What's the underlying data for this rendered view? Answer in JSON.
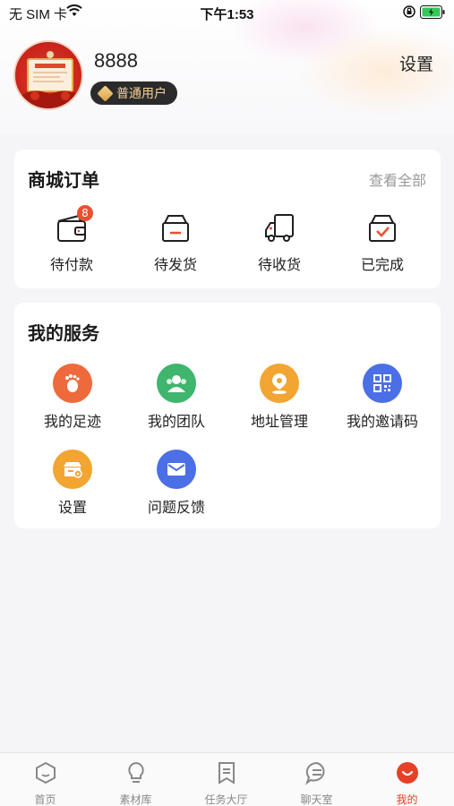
{
  "status_bar": {
    "carrier": "无 SIM 卡",
    "time": "下午1:53"
  },
  "profile": {
    "username": "8888",
    "badge": "普通用户",
    "settings": "设置"
  },
  "orders": {
    "title": "商城订单",
    "view_all": "查看全部",
    "items": [
      {
        "label": "待付款",
        "icon": "wallet-icon",
        "count": "8"
      },
      {
        "label": "待发货",
        "icon": "box-icon"
      },
      {
        "label": "待收货",
        "icon": "truck-icon"
      },
      {
        "label": "已完成",
        "icon": "box-check-icon"
      }
    ]
  },
  "services": {
    "title": "我的服务",
    "items": [
      {
        "label": "我的足迹",
        "icon": "footprint-icon",
        "color": "#ee6a3c"
      },
      {
        "label": "我的团队",
        "icon": "team-icon",
        "color": "#3fb56d"
      },
      {
        "label": "地址管理",
        "icon": "location-icon",
        "color": "#f2a531"
      },
      {
        "label": "我的邀请码",
        "icon": "qrcode-icon",
        "color": "#4b6fe6"
      },
      {
        "label": "设置",
        "icon": "settings-icon",
        "color": "#f2a531"
      },
      {
        "label": "问题反馈",
        "icon": "mail-icon",
        "color": "#4b6fe6"
      }
    ]
  },
  "tabbar": {
    "active_color": "#e64027",
    "items": [
      {
        "label": "首页",
        "icon": "home-icon"
      },
      {
        "label": "素材库",
        "icon": "bulb-icon"
      },
      {
        "label": "任务大厅",
        "icon": "bookmark-icon"
      },
      {
        "label": "聊天室",
        "icon": "chat-icon"
      },
      {
        "label": "我的",
        "icon": "profile-icon"
      }
    ]
  }
}
